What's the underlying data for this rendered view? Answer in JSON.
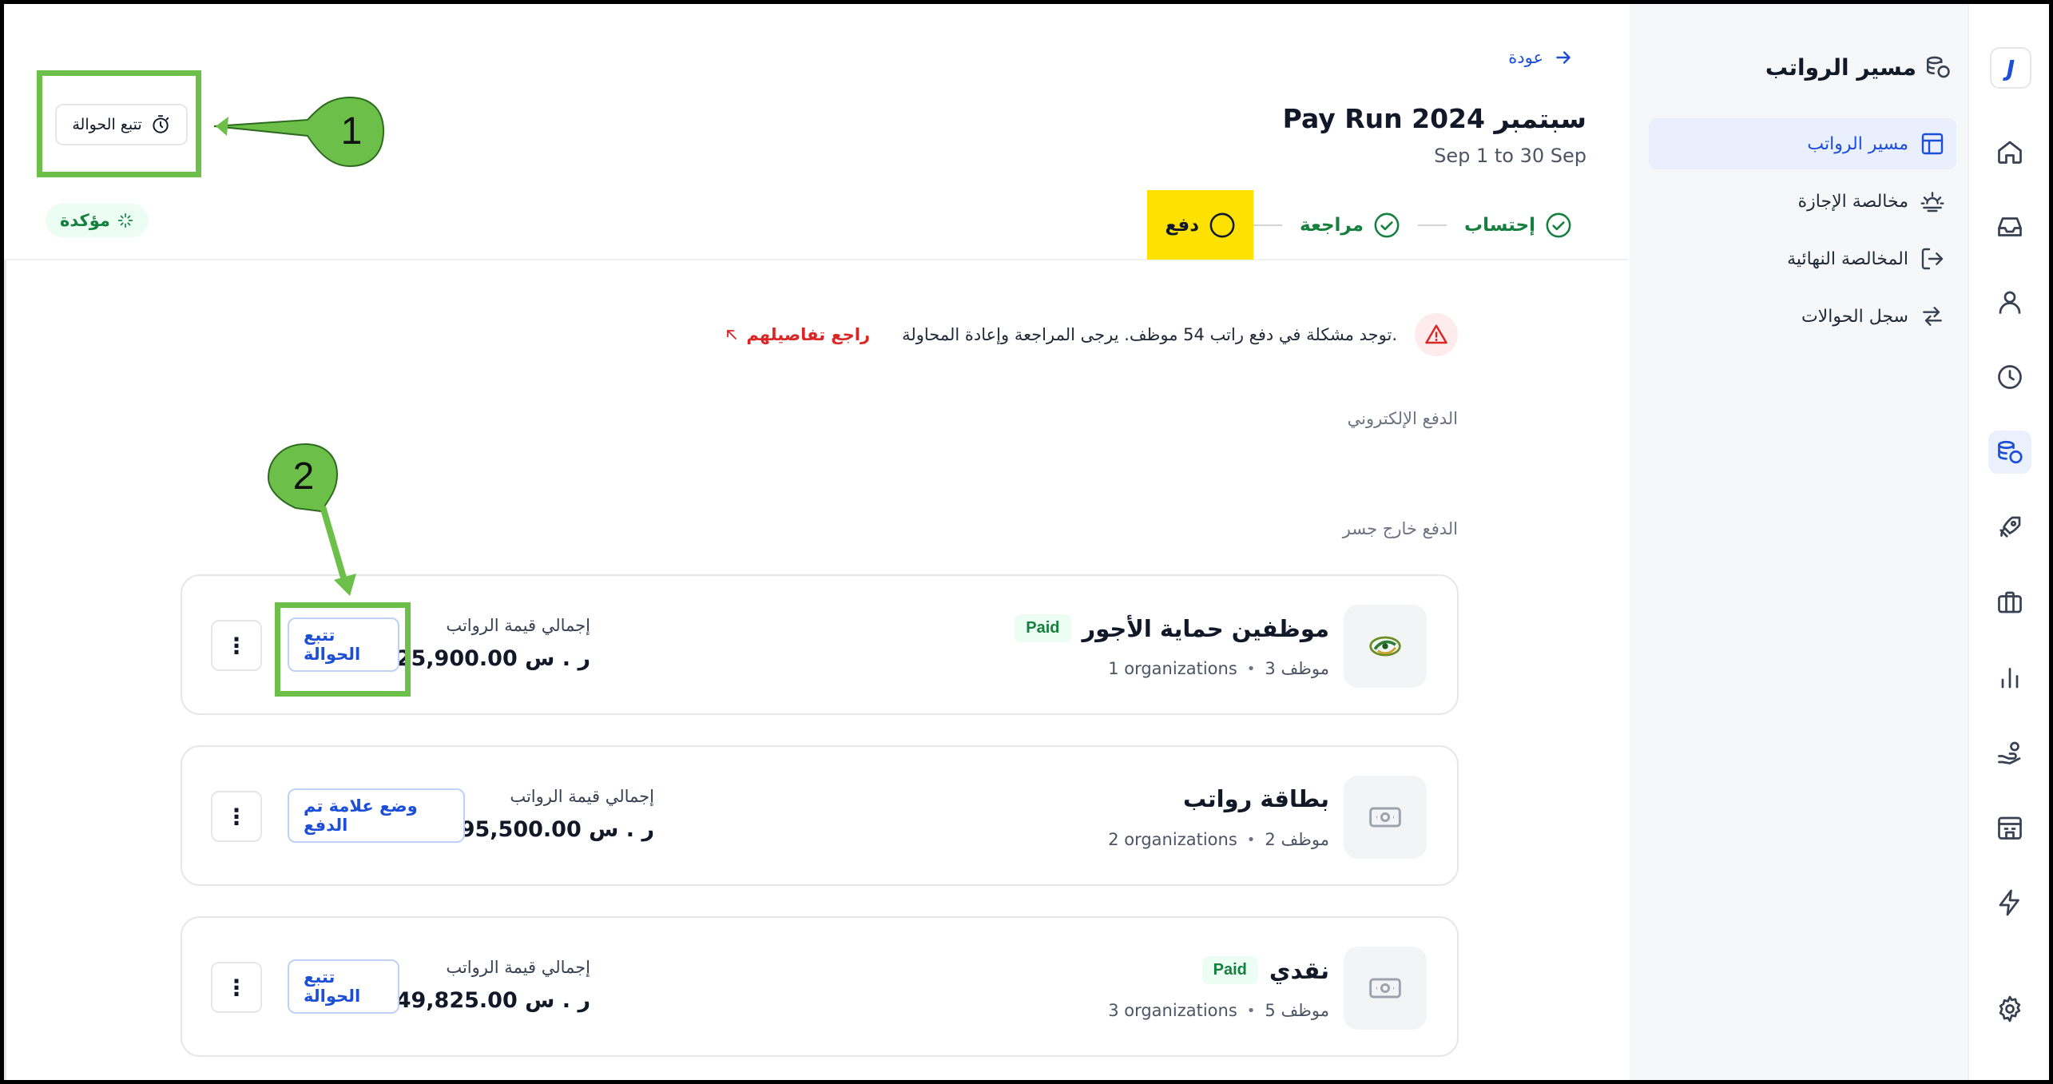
{
  "rail": {
    "logo": "J",
    "icons": [
      "home-icon",
      "inbox-icon",
      "user-icon",
      "clock-icon",
      "payroll-icon",
      "rocket-icon",
      "briefcase-icon",
      "chart-icon",
      "hand-coins-icon",
      "building-icon",
      "lightning-icon",
      "gear-icon"
    ]
  },
  "sidenav": {
    "title": "مسير الرواتب",
    "items": [
      {
        "label": "مسير الرواتب",
        "icon": "table-icon",
        "active": true
      },
      {
        "label": "مخالصة الإجازة",
        "icon": "sunset-icon",
        "active": false
      },
      {
        "label": "المخالصة النهائية",
        "icon": "logout-icon",
        "active": false
      },
      {
        "label": "سجل الحوالات",
        "icon": "transfer-arrows-icon",
        "active": false
      }
    ]
  },
  "header": {
    "back": "عودة",
    "title": "سبتمبر 2024 Pay Run",
    "subtitle": "Sep 1 to 30 Sep",
    "steps": [
      {
        "label": "إحتساب",
        "state": "done"
      },
      {
        "label": "مراجعة",
        "state": "done"
      },
      {
        "label": "دفع",
        "state": "current"
      }
    ],
    "track_button": "تتبع الحوالة",
    "status_badge": "مؤكدة"
  },
  "alert": {
    "message": "توجد مشكلة في دفع راتب 54 موظف. يرجى المراجعة وإعادة المحاولة.",
    "link": "راجع تفاصيلهم"
  },
  "sections": {
    "electronic": "الدفع الإلكتروني",
    "outside": "الدفع خارج جسر"
  },
  "cards": [
    {
      "name": "موظفين حماية الأجور",
      "paid": "Paid",
      "employees": "3 موظف",
      "orgs": "1 organizations",
      "total_label": "إجمالي قيمة الرواتب",
      "total": "25,900.00 ر . س",
      "action": "تتبع الحوالة",
      "more": "⋮"
    },
    {
      "name": "بطاقة رواتب",
      "paid": "",
      "employees": "2 موظف",
      "orgs": "2 organizations",
      "total_label": "إجمالي قيمة الرواتب",
      "total": "95,500.00 ر . س",
      "action": "وضع علامة تم الدفع",
      "more": "⋮"
    },
    {
      "name": "نقدي",
      "paid": "Paid",
      "employees": "5 موظف",
      "orgs": "3 organizations",
      "total_label": "إجمالي قيمة الرواتب",
      "total": "49,825.00 ر . س",
      "action": "تتبع الحوالة",
      "more": "⋮"
    }
  ],
  "annotations": {
    "callout_1": "1",
    "callout_2": "2",
    "color": "#6cc04a",
    "highlight": "#ffe100"
  }
}
